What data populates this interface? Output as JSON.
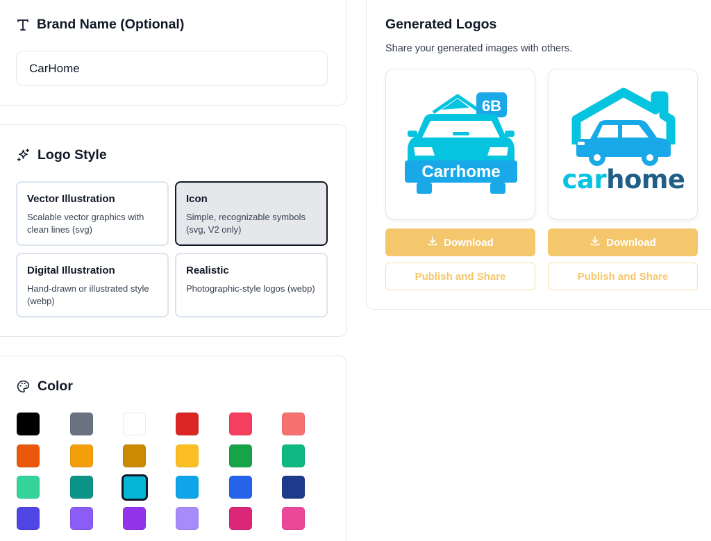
{
  "brand": {
    "title": "Brand Name (Optional)",
    "icon": "text-type-icon",
    "input_value": "CarHome"
  },
  "logo_style": {
    "title": "Logo Style",
    "icon": "sparkles-icon",
    "selected": "Icon",
    "options": [
      {
        "name": "Vector Illustration",
        "desc": "Scalable vector graphics with clean lines (svg)"
      },
      {
        "name": "Icon",
        "desc": "Simple, recognizable symbols (svg, V2 only)"
      },
      {
        "name": "Digital Illustration",
        "desc": "Hand-drawn or illustrated style (webp)"
      },
      {
        "name": "Realistic",
        "desc": "Photographic-style logos (webp)"
      }
    ]
  },
  "color": {
    "title": "Color",
    "icon": "palette-icon",
    "selected": "#06b6d4",
    "swatches": [
      "#000000",
      "#6b7280",
      "#ffffff",
      "#dc2626",
      "#f43f5e",
      "#f87171",
      "#ea580c",
      "#f59e0b",
      "#ca8a04",
      "#fbbf24",
      "#16a34a",
      "#10b981",
      "#34d399",
      "#0d9488",
      "#06b6d4",
      "#0ea5e9",
      "#2563eb",
      "#1e3a8a",
      "#4f46e5",
      "#8b5cf6",
      "#9333ea",
      "#a78bfa",
      "#db2777",
      "#ec4899"
    ]
  },
  "generated": {
    "title": "Generated Logos",
    "subtitle": "Share your generated images with others.",
    "logos": [
      {
        "text": "Carrhome",
        "badge": "6B",
        "download_label": "Download",
        "share_label": "Publish and Share"
      },
      {
        "text_part1": "car",
        "text_part2": "home",
        "download_label": "Download",
        "share_label": "Publish and Share"
      }
    ]
  },
  "colors": {
    "accent": "#f4c76c",
    "logo_cyan": "#06c4e0",
    "logo_blue": "#1aa9e8",
    "logo_navy": "#1f5f87"
  }
}
